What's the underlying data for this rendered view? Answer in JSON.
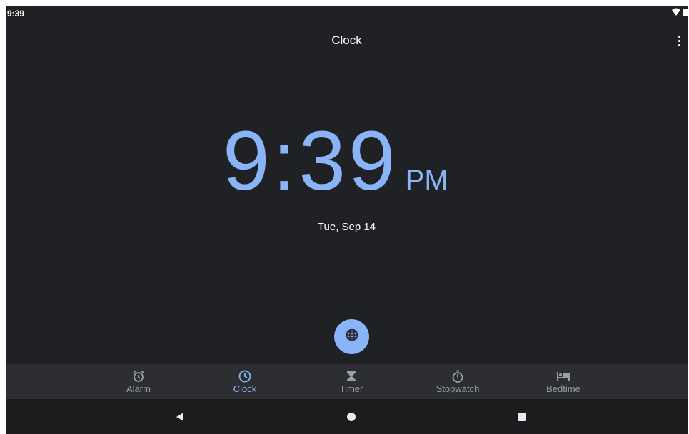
{
  "status_bar": {
    "time": "9:39",
    "icons": [
      "wifi-icon",
      "battery-icon"
    ]
  },
  "header": {
    "title": "Clock",
    "menu_icon": "more-vert-icon"
  },
  "clock": {
    "time": "9:39",
    "ampm": "PM",
    "date": "Tue, Sep 14"
  },
  "fab": {
    "icon": "globe-icon"
  },
  "bottom_nav": {
    "active": "Clock",
    "items": [
      {
        "label": "Alarm",
        "icon": "alarm-icon"
      },
      {
        "label": "Clock",
        "icon": "clock-icon"
      },
      {
        "label": "Timer",
        "icon": "hourglass-icon"
      },
      {
        "label": "Stopwatch",
        "icon": "stopwatch-icon"
      },
      {
        "label": "Bedtime",
        "icon": "bed-icon"
      }
    ]
  },
  "system_nav": {
    "icons": [
      "back-icon",
      "home-icon",
      "recents-icon"
    ]
  },
  "colors": {
    "background": "#202124",
    "accent": "#8ab4f8",
    "nav_bar": "#2d2e31",
    "inactive": "#9aa0a6"
  }
}
